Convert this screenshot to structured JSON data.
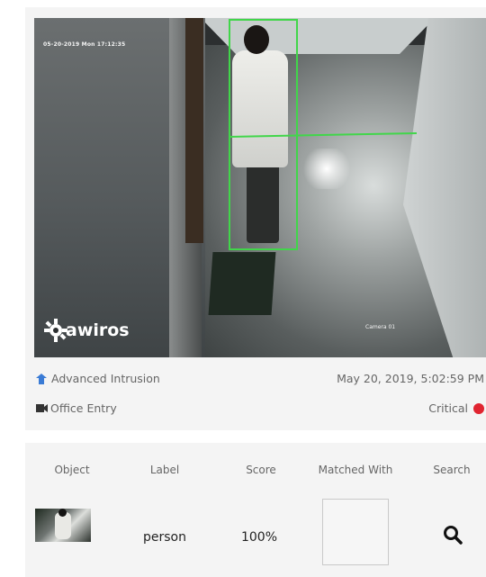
{
  "video": {
    "timestamp": "05-20-2019 Mon 17:12:35",
    "camera_label": "Camera 01",
    "logo_text": "awiros"
  },
  "alert": {
    "type": "Advanced Intrusion",
    "datetime": "May 20, 2019, 5:02:59 PM",
    "location": "Office Entry",
    "severity": "Critical",
    "severity_color": "#e02430",
    "type_icon": "intrusion-icon",
    "location_icon": "video-camera-icon"
  },
  "table": {
    "headers": [
      "Object",
      "Label",
      "Score",
      "Matched With",
      "Search"
    ],
    "rows": [
      {
        "label": "person",
        "score": "100%"
      }
    ]
  },
  "colors": {
    "detection_box": "#41d64a",
    "accent_blue": "#3a7bd5"
  }
}
